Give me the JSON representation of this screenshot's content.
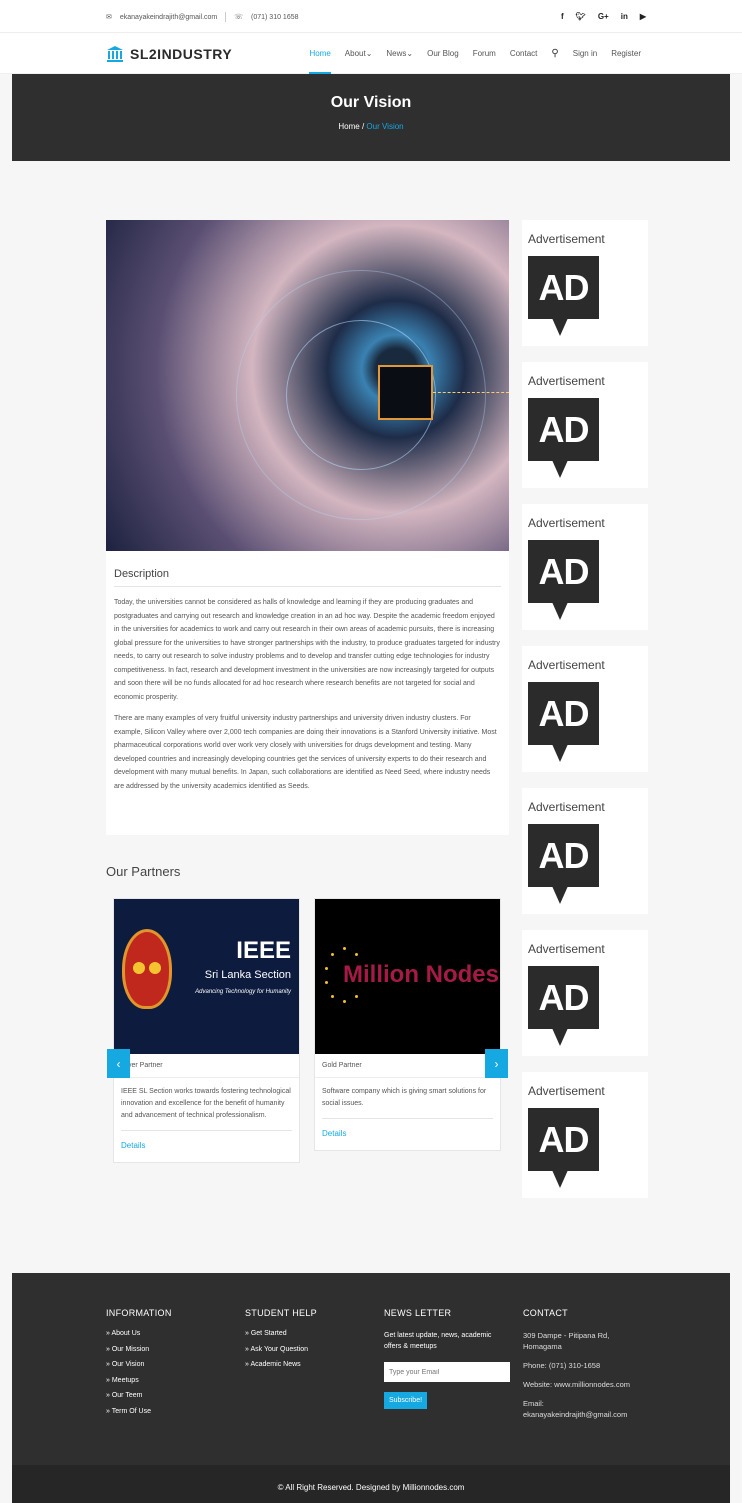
{
  "topbar": {
    "email": "ekanayakeindrajith@gmail.com",
    "phone": "(071) 310 1658",
    "social": [
      "f",
      "y",
      "G+",
      "in",
      "yt"
    ]
  },
  "header": {
    "brand": "SL2INDUSTRY",
    "nav": [
      "Home",
      "About",
      "News",
      "Our Blog",
      "Forum",
      "Contact",
      "Sign in",
      "Register"
    ],
    "active": "Home"
  },
  "banner": {
    "title": "Our Vision",
    "crumb_home": "Home",
    "crumb_sep": "/",
    "crumb_current": "Our Vision"
  },
  "content": {
    "desc_title": "Description",
    "para1": "Today, the universities cannot be considered as halls of knowledge and learning if they are producing graduates and postgraduates and carrying out research and knowledge creation in an ad hoc way. Despite the academic freedom enjoyed in the universities for academics to work and carry out research in their own areas of academic pursuits, there is increasing global pressure for the universities to have stronger partnerships with the industry, to produce graduates targeted for industry needs, to carry out research to solve industry problems and to develop and transfer cutting edge technologies for industry competitiveness. In fact, research and development investment in the universities are now increasingly targeted for outputs and soon there will be no funds allocated for ad hoc research where research benefits are not targeted for social and economic prosperity.",
    "para2": "There are many examples of very fruitful university industry partnerships and university driven industry clusters. For example, Silicon Valley where over 2,000 tech companies are doing their innovations is a Stanford University initiative. Most pharmaceutical corporations world over work very closely with universities for drugs development and testing. Many developed countries and increasingly developing countries get the services of university experts to do their research and development with many mutual benefits. In Japan, such collaborations are identified as Need Seed, where industry needs are addressed by the university academics identified as Seeds."
  },
  "partners": {
    "title": "Our Partners",
    "items": [
      {
        "type": "ver Partner",
        "logo": "IEEE",
        "logo_sub": "Sri Lanka Section",
        "logo_tag": "Advancing Technology for Humanity",
        "desc": "IEEE SL Section works towards fostering technological innovation and excellence for the benefit of humanity and advancement of technical professionalism.",
        "link": "Details"
      },
      {
        "type": "Gold Partner",
        "logo": "Million Nodes",
        "desc": "Software company which is giving smart solutions for social issues.",
        "link": "Details"
      }
    ]
  },
  "ads": {
    "label": "Advertisement",
    "badge": "AD",
    "count": 7
  },
  "footer": {
    "info_title": "INFORMATION",
    "info_links": [
      "About Us",
      "Our Mission",
      "Our Vision",
      "Meetups",
      "Our Teem",
      "Term Of Use"
    ],
    "help_title": "STUDENT HELP",
    "help_links": [
      "Get Started",
      "Ask Your Question",
      "Academic News"
    ],
    "news_title": "NEWS LETTER",
    "news_text": "Get latest update, news, academic offers & meetups",
    "email_placeholder": "Type your Email",
    "subscribe": "Subscribe!",
    "contact_title": "CONTACT",
    "address": "309 Dampe - Pitipana Rd, Homagama",
    "phone": "Phone: (071) 310-1658",
    "website": "Website: www.millionnodes.com",
    "email": "Email: ekanayakeindrajith@gmail.com"
  },
  "copyright": "© All Right Reserved. Designed by Millionnodes.com",
  "colors": {
    "accent": "#16a8e1",
    "dark": "#2f2f2f"
  }
}
